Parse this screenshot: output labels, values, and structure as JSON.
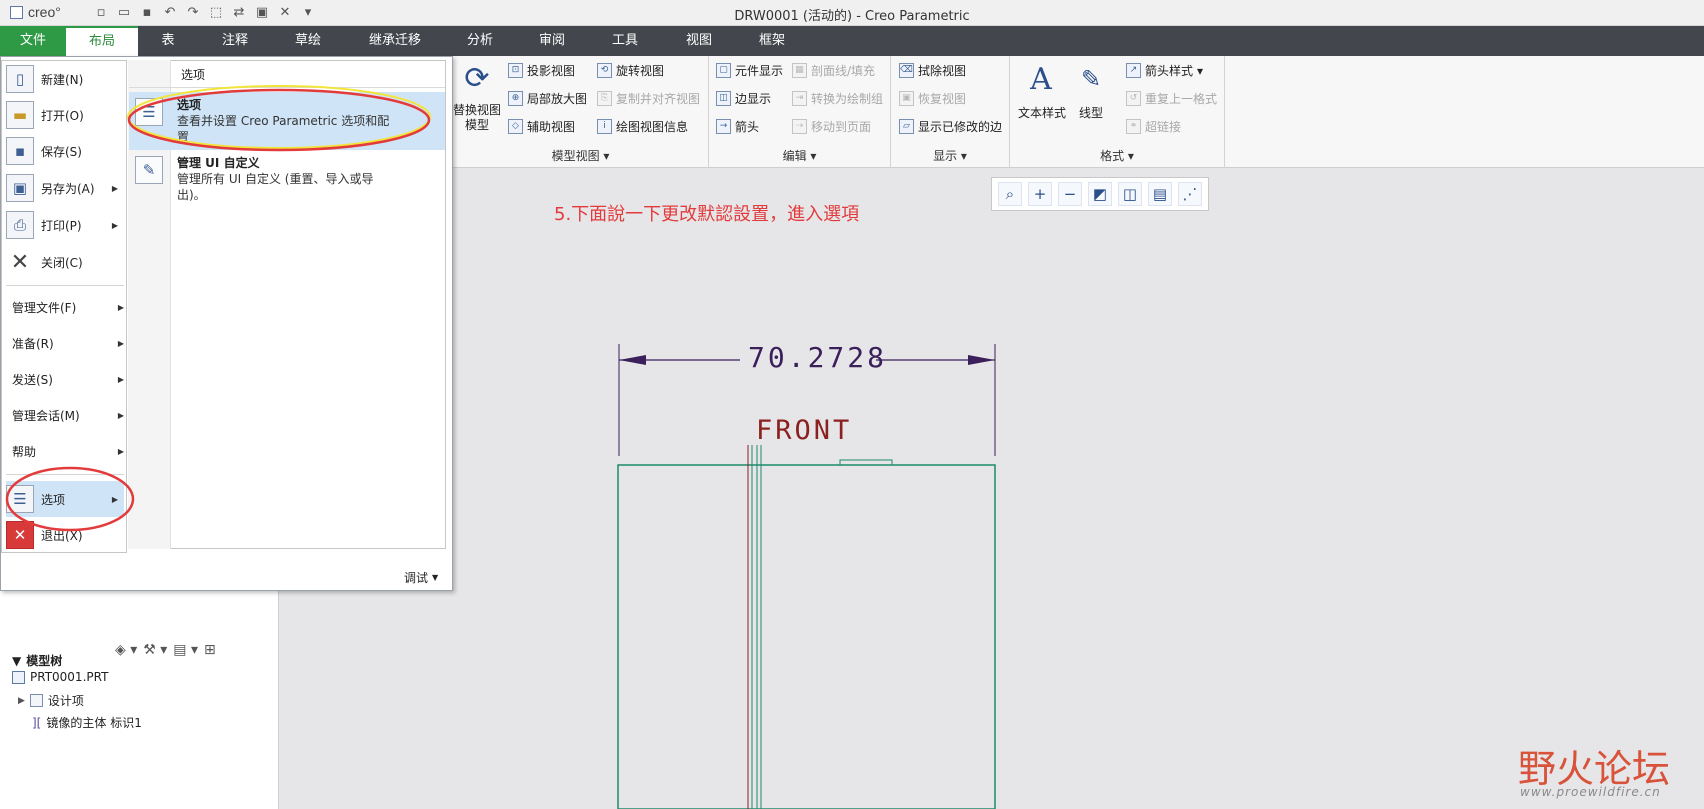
{
  "window": {
    "logo": "creo°",
    "title": "DRW0001 (活动的) - Creo Parametric"
  },
  "quick_access": [
    "new-icon",
    "open-icon",
    "save-icon",
    "undo-icon",
    "redo-icon",
    "select-box-icon",
    "regenerate-icon",
    "windows-icon",
    "close-window-icon",
    "customize-icon"
  ],
  "tabs": [
    "文件",
    "布局",
    "表",
    "注释",
    "草绘",
    "继承迁移",
    "分析",
    "审阅",
    "工具",
    "视图",
    "框架"
  ],
  "ribbon": {
    "model_views": {
      "label": "模型视图",
      "big": "替换视图\n模型",
      "items": [
        {
          "text": "投影视图",
          "enabled": true
        },
        {
          "text": "局部放大图",
          "enabled": true
        },
        {
          "text": "辅助视图",
          "enabled": true
        },
        {
          "text": "旋转视图",
          "enabled": true
        },
        {
          "text": "复制并对齐视图",
          "enabled": false
        },
        {
          "text": "绘图视图信息",
          "enabled": true
        }
      ]
    },
    "edit": {
      "label": "编辑",
      "items": [
        {
          "text": "元件显示",
          "enabled": true
        },
        {
          "text": "边显示",
          "enabled": true
        },
        {
          "text": "箭头",
          "enabled": true
        },
        {
          "text": "剖面线/填充",
          "enabled": false
        },
        {
          "text": "转换为绘制组",
          "enabled": false
        },
        {
          "text": "移动到页面",
          "enabled": false
        }
      ]
    },
    "display": {
      "label": "显示",
      "items": [
        {
          "text": "拭除视图",
          "enabled": true
        },
        {
          "text": "恢复视图",
          "enabled": false
        },
        {
          "text": "显示已修改的边",
          "enabled": true
        }
      ]
    },
    "format": {
      "label": "格式",
      "text_style": "文本样式",
      "line_style": "线型",
      "items": [
        {
          "text": "箭头样式",
          "enabled": true
        },
        {
          "text": "重复上一格式",
          "enabled": false
        },
        {
          "text": "超链接",
          "enabled": false
        }
      ]
    }
  },
  "annotation": "5.下面說一下更改默認設置，進入選項",
  "drawing": {
    "dimension": "70.2728",
    "view_label": "FRONT"
  },
  "file_menu": {
    "items_top": [
      {
        "label": "新建(N)",
        "icon": "new-file-icon"
      },
      {
        "label": "打开(O)",
        "icon": "open-folder-icon"
      },
      {
        "label": "保存(S)",
        "icon": "save-icon"
      },
      {
        "label": "另存为(A)",
        "icon": "save-as-icon",
        "arrow": true
      },
      {
        "label": "打印(P)",
        "icon": "print-icon",
        "arrow": true
      },
      {
        "label": "关闭(C)",
        "icon": "close-icon"
      }
    ],
    "items_text": [
      "管理文件(F)",
      "准备(R)",
      "发送(S)",
      "管理会话(M)",
      "帮助"
    ],
    "options": "选项",
    "exit": "退出(X)"
  },
  "submenu": {
    "header": "选项",
    "items": [
      {
        "title": "选项",
        "desc": "查看并设置 Creo Parametric 选项和配置"
      },
      {
        "title": "管理 UI 自定义",
        "desc": "管理所有 UI 自定义 (重置、导入或导出)。"
      }
    ],
    "debug": "调试"
  },
  "model_tree": {
    "title": "模型树",
    "items": [
      "PRT0001.PRT",
      "设计项",
      "镜像的主体 标识1"
    ]
  },
  "watermark": {
    "text": "野火论坛",
    "url": "www.proewildfire.cn"
  },
  "colors": {
    "accent_green": "#2f9a45",
    "tab_bar": "#43474d",
    "highlight": "#cfe4f7",
    "red_annotation": "#e33b3b"
  }
}
